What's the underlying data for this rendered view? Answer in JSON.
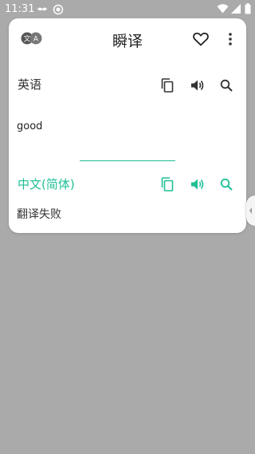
{
  "status_bar": {
    "time": "11:31",
    "icons": [
      "mustache-icon",
      "lines-icon",
      "target-icon",
      "wifi-icon",
      "signal-icon",
      "battery-icon"
    ]
  },
  "header": {
    "logo_icon": "translate-logo-icon",
    "logo_text_left": "文",
    "logo_text_right": "A",
    "title": "瞬译",
    "favorite_icon": "heart-icon",
    "more_icon": "more-vert-icon"
  },
  "source": {
    "language": "英语",
    "text": "good",
    "actions": [
      "copy-icon",
      "volume-icon",
      "search-icon"
    ]
  },
  "target": {
    "language": "中文(简体)",
    "text": "翻译失败",
    "actions": [
      "copy-icon",
      "volume-icon",
      "search-icon"
    ]
  },
  "colors": {
    "accent": "#1fbf95",
    "background": "#aaaaaa",
    "card": "#ffffff",
    "icon_dark": "#333333"
  }
}
